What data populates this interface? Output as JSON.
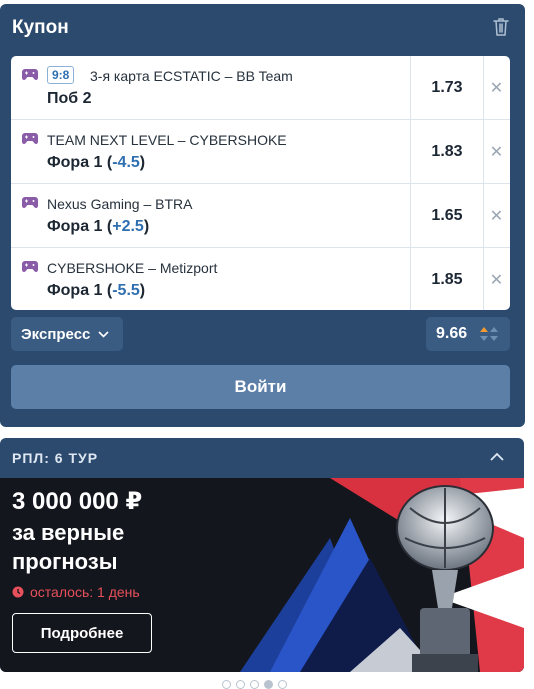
{
  "coupon": {
    "title": "Купон",
    "bets": [
      {
        "score": "9:8",
        "match": "3-я карта ECSTATIC – BB Team",
        "outcome": "Поб 2",
        "handicap": "",
        "odds": "1.73"
      },
      {
        "score": "",
        "match": "TEAM NEXT LEVEL – CYBERSHOKE",
        "outcome": "Фора 1 (",
        "handicap": "-4.5",
        "close_paren": ")",
        "odds": "1.83"
      },
      {
        "score": "",
        "match": "Nexus Gaming – BTRA",
        "outcome": "Фора 1 (",
        "handicap": "+2.5",
        "close_paren": ")",
        "odds": "1.65"
      },
      {
        "score": "",
        "match": "CYBERSHOKE – Metizport",
        "outcome": "Фора 1 (",
        "handicap": "-5.5",
        "close_paren": ")",
        "odds": "1.85"
      }
    ],
    "bet_type": "Экспресс",
    "total_odds": "9.66",
    "login_label": "Войти"
  },
  "promo": {
    "header": "РПЛ: 6 ТУР",
    "amount": "3 000 000 ₽",
    "subtitle": "за верные прогнозы",
    "remaining": "осталось: 1 день",
    "more_label": "Подробнее"
  },
  "pagination": {
    "count": 5,
    "active_index": 3
  },
  "colors": {
    "panel": "#2c4a6e",
    "accent": "#2f6fb0",
    "gamepad": "#8a5ca8",
    "urgent": "#e8505b"
  },
  "icons": [
    "trash-icon",
    "gamepad-icon",
    "close-icon",
    "chevron-down-icon",
    "odds-arrows-icon",
    "chevron-up-icon",
    "clock-icon"
  ]
}
